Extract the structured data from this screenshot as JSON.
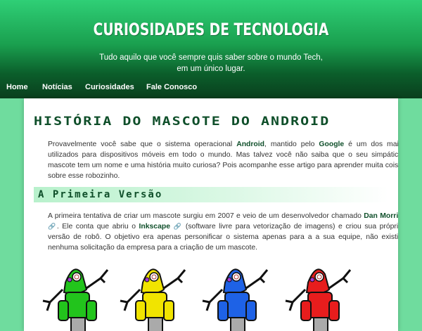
{
  "header": {
    "title": "CURIOSIDADES DE TECNOLOGIA",
    "subtitle_line1": "Tudo aquilo que você sempre quis saber sobre o mundo Tech,",
    "subtitle_line2": "em um único lugar."
  },
  "nav": {
    "items": [
      "Home",
      "Notícias",
      "Curiosidades",
      "Fale Conosco"
    ]
  },
  "article": {
    "title": "História do Mascote do Android",
    "intro": {
      "t1": "Provavelmente você sabe que o sistema operacional ",
      "b1": "Android",
      "t2": ", mantido pelo ",
      "b2": "Google",
      "t3": " é um dos mais utilizados para dispositivos móveis em todo o mundo. Mas talvez você não saiba que o seu simpático mascote tem um nome e uma história muito curiosa? Pois acompanhe esse artigo para aprender muita coisa sobre esse robozinho."
    },
    "section1": {
      "heading": "A Primeira Versão",
      "t1": "A primeira tentativa de criar um mascote surgiu em 2007 e veio de um desenvolvedor chamado ",
      "b1": "Dan Morrill",
      "t2": ". Ele conta que abriu o ",
      "b2": "Inkscape",
      "t3": " (software livre para vetorização de imagens) e criou sua própria versão de robô. O objetivo era apenas personificar o sistema apenas para a a sua equipe, não existia nenhuma solicitação da empresa para a criação de um mascote."
    },
    "robot_colors": [
      "#22c41c",
      "#f1e400",
      "#1e62e6",
      "#e81d1d"
    ],
    "link_icon": "🔗"
  }
}
